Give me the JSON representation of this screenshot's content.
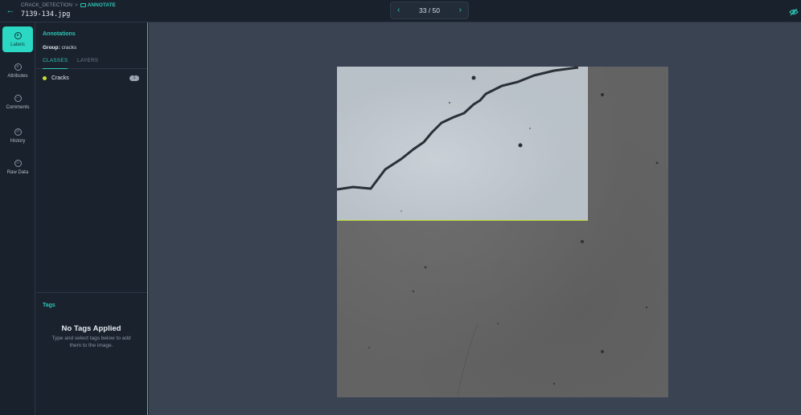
{
  "header": {
    "back_icon": "arrow-left-icon",
    "breadcrumb": {
      "project": "CRACK_DETECTION",
      "separator": ">",
      "mode": "ANNOTATE"
    },
    "filename": "7139-134.jpg",
    "pager": {
      "prev_icon": "chevron-left-icon",
      "position": "33 / 50",
      "next_icon": "chevron-right-icon"
    },
    "visibility_icon": "eye-off-icon"
  },
  "rail": {
    "items": [
      {
        "label": "Labels",
        "icon": "label-icon",
        "active": true
      },
      {
        "label": "Attributes",
        "icon": "attributes-icon",
        "active": false
      },
      {
        "label": "Comments",
        "icon": "comment-icon",
        "active": false
      },
      {
        "label": "History",
        "icon": "history-icon",
        "active": false
      },
      {
        "label": "Raw Data",
        "icon": "code-icon",
        "active": false
      }
    ]
  },
  "panel": {
    "title": "Annotations",
    "group_label": "Group:",
    "group_value": "cracks",
    "tabs": [
      "CLASSES",
      "LAYERS"
    ],
    "classes": [
      {
        "name": "Cracks",
        "count": "1",
        "color": "#c6e03a"
      }
    ],
    "tags": {
      "title": "Tags",
      "empty_title": "No Tags Applied",
      "empty_text": "Type and select tags below to add them to the image."
    }
  },
  "colors": {
    "accent": "#2ec4b6",
    "annotation": "#c6e03a",
    "canvas": "#3a4352"
  }
}
